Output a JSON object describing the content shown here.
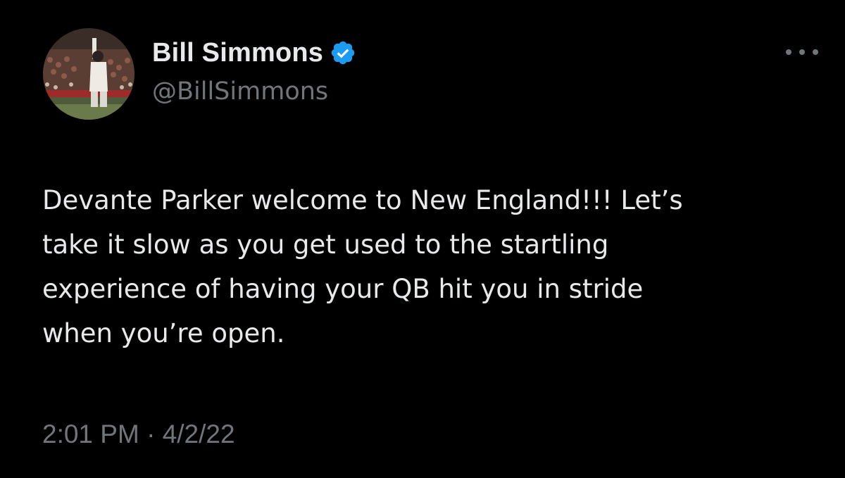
{
  "author": {
    "display_name": "Bill Simmons",
    "handle": "@BillSimmons",
    "verified": true,
    "avatar_icon": "baseball-player-avatar",
    "verified_color": "#1d9bf0"
  },
  "tweet": {
    "text": "Devante Parker welcome to New England!!! Let’s\ntake it slow as you get used to the startling\nexperience of having your QB hit you in stride\nwhen you’re open.",
    "time": "2:01 PM",
    "separator": " · ",
    "date": "4/2/22"
  },
  "menu": {
    "icon": "more-options-icon"
  },
  "colors": {
    "background": "#000000",
    "primary_text": "#e7e9ea",
    "secondary_text": "#71767b"
  }
}
